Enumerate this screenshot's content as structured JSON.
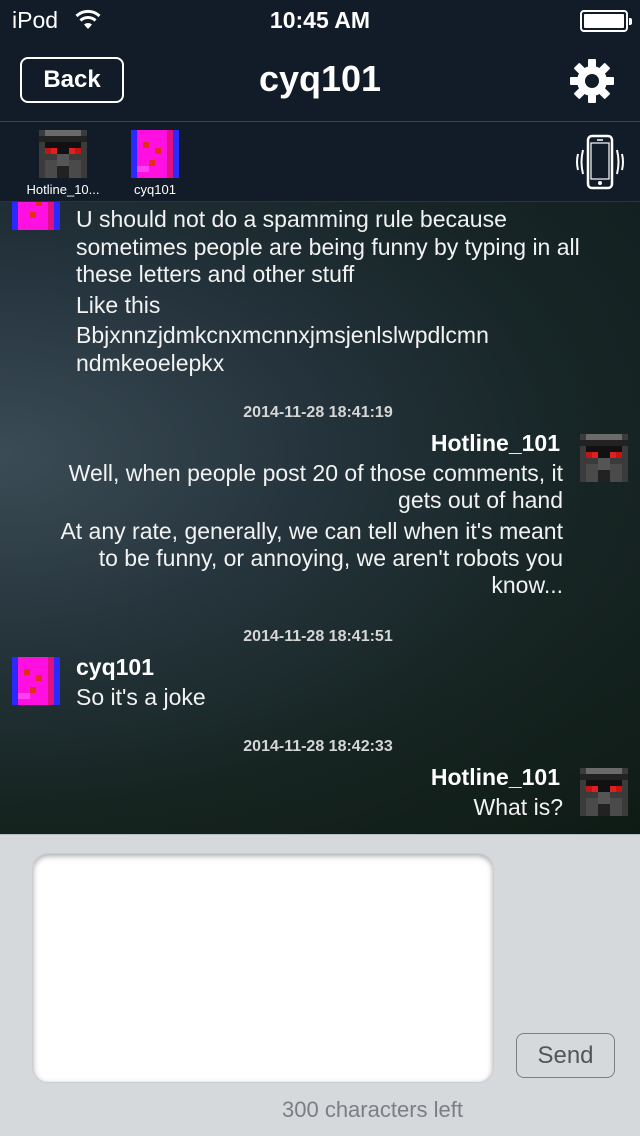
{
  "status_bar": {
    "carrier": "iPod",
    "time": "10:45 AM",
    "wifi_icon": "wifi-icon",
    "battery_icon": "battery-full-icon"
  },
  "nav": {
    "back_label": "Back",
    "title": "cyq101",
    "settings_icon": "gear-icon"
  },
  "participants": [
    {
      "name": "Hotline_10...",
      "avatar": "robot-avatar"
    },
    {
      "name": "cyq101",
      "avatar": "pink-pixel-avatar"
    }
  ],
  "vibrate_icon": "phone-vibrate-icon",
  "messages": [
    {
      "sender": "",
      "side": "left",
      "lines": [
        "U should not do a spamming rule because",
        "sometimes people are being funny by typing in all",
        "these letters and other stuff",
        "Like this",
        "Bbjxnnzjdmkcnxmcnnxjmsjenlslwpdlcmn",
        "ndmkeoelepkx"
      ]
    },
    {
      "timestamp": "2014-11-28 18:41:19",
      "sender": "Hotline_101",
      "side": "right",
      "lines": [
        "Well, when people post 20 of those comments, it",
        "gets out of hand",
        "At any rate, generally, we can tell when it's meant",
        "to be funny, or annoying, we aren't robots you",
        "know..."
      ]
    },
    {
      "timestamp": "2014-11-28 18:41:51",
      "sender": "cyq101",
      "side": "left",
      "lines": [
        "So it's a joke"
      ]
    },
    {
      "timestamp": "2014-11-28 18:42:33",
      "sender": "Hotline_101",
      "side": "right",
      "lines": [
        "What is?"
      ]
    }
  ],
  "composer": {
    "input_value": "",
    "send_label": "Send",
    "counter": "300 characters left"
  }
}
